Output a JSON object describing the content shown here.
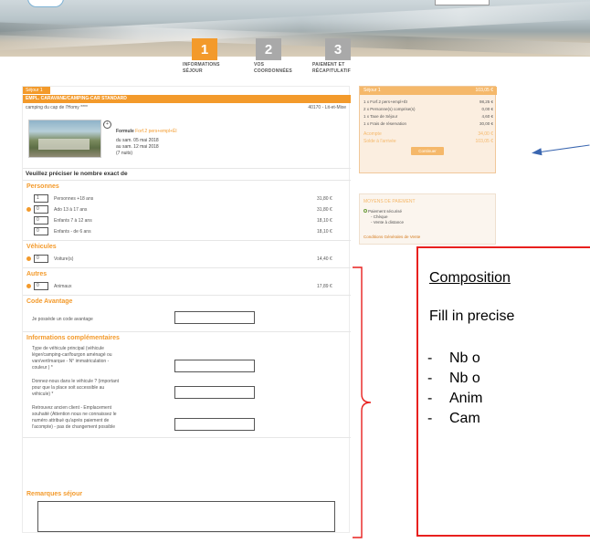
{
  "steps": [
    {
      "num": "1",
      "label_line1": "INFORMATIONS",
      "label_line2": "SÉJOUR",
      "active": true
    },
    {
      "num": "2",
      "label_line1": "VOS",
      "label_line2": "COORDONNÉES",
      "active": false
    },
    {
      "num": "3",
      "label_line1": "PAIEMENT ET",
      "label_line2": "RÉCAPITULATIF",
      "active": false
    }
  ],
  "stay": {
    "tab_label": "Séjour 1",
    "camp_type": "EMPL. CARAVANE/CAMPING-CAR STANDARD",
    "camp_name": "camping du cap de l'Homy ****",
    "camp_location": "40170 - Lit-et-Mixe",
    "offer_prefix": "Formule",
    "offer_name": "Forf.2 pers+empl+ÉI",
    "date_from": "du sam. 05 mai 2018",
    "date_to": "au sam. 12 mai 2018",
    "nights": "(7 nuits)"
  },
  "question": "Veuillez préciser le nombre exact de",
  "sections": {
    "persons": {
      "title": "Personnes",
      "rows": [
        {
          "value": "1",
          "label": "Personnes +18 ans",
          "price": "31,80 €",
          "required": false
        },
        {
          "value": "0",
          "label": "Ado 13 à 17 ans",
          "price": "31,80 €",
          "required": true
        },
        {
          "value": "0",
          "label": "Enfants 7 à 12 ans",
          "price": "18,10 €",
          "required": false
        },
        {
          "value": "0",
          "label": "Enfants - de 6 ans",
          "price": "18,10 €",
          "required": false
        }
      ]
    },
    "vehicles": {
      "title": "Véhicules",
      "rows": [
        {
          "value": "0",
          "label": "Voiture(s)",
          "price": "14,40 €",
          "required": true
        }
      ]
    },
    "others": {
      "title": "Autres",
      "rows": [
        {
          "value": "0",
          "label": "Animaux",
          "price": "17,89 €",
          "required": true
        }
      ]
    },
    "code": {
      "title": "Code Avantage",
      "label": "Je possède un code avantage"
    },
    "extra": {
      "title": "Informations complémentaires",
      "q1": [
        "Type de véhicule principal (véhicule",
        "léger/camping-car/fourgon aménagé ou",
        "van/vert/marque - N° immatriculation -",
        "couleur ) *"
      ],
      "q2": [
        "Donnez-nous dans le véhicule ? (important",
        "pour que la place soit accessible au",
        "véhicule) *"
      ],
      "q3": [
        "Retrouvez ancien client - Emplacement",
        "souhaité (Attention nous ne connaissez le",
        "numéro attribué qu'après paiement de",
        "l'acompte) - pas de changement possible"
      ]
    },
    "remarks": {
      "title": "Remarques séjour"
    }
  },
  "summary": {
    "header_left": "Séjour 1",
    "header_right": "103,05 €",
    "rows": [
      {
        "label": "1 x Forf.2 pers+empl+ÉI",
        "value": "98,25 €"
      },
      {
        "label": "2 x Personne(s) comprise(s)",
        "value": "0,00 €"
      },
      {
        "label": "1 x Taxe de Séjour",
        "value": "4,60 €"
      },
      {
        "label": "1 x Frais de réservation",
        "value": "30,00 €"
      }
    ],
    "acompte_label": "Acompte",
    "acompte_value": "34,00 €",
    "total_label": "Solde à l'arrivée",
    "total_value": "103,05 €",
    "continue_label": "Continuer"
  },
  "payment": {
    "title": "Moyens de paiement",
    "option": "Paiement sécurisé",
    "sub1": "- Chèque",
    "sub2": "- Vente à distance",
    "link": "Conditions Générales de Vente"
  },
  "annotation": {
    "title": "Composition",
    "body": "Fill in precise",
    "items": [
      "Nb o",
      "Nb o",
      "Anim",
      "Cam"
    ]
  }
}
